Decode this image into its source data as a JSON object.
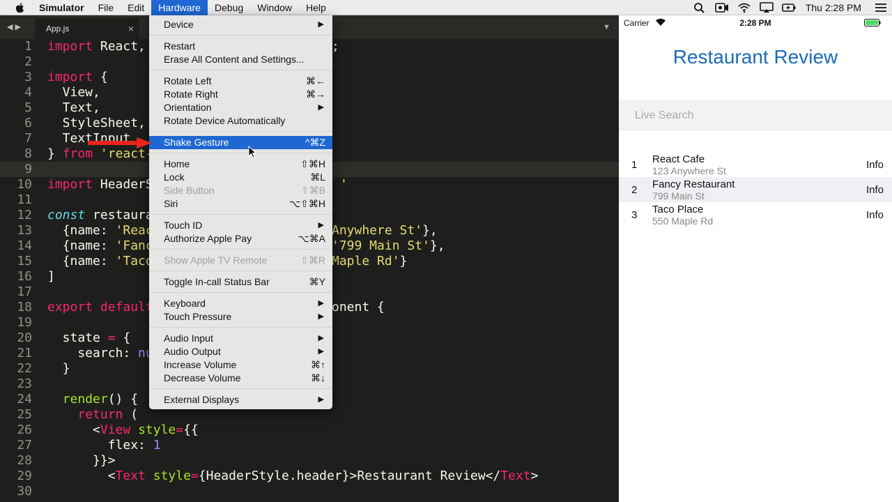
{
  "menubar": {
    "app": "Simulator",
    "items": [
      "File",
      "Edit",
      "Hardware",
      "Debug",
      "Window",
      "Help"
    ],
    "active": "Hardware",
    "clock": "Thu 2:28 PM"
  },
  "editor": {
    "tab": "App.js",
    "close": "×",
    "lines": [
      {
        "n": "1",
        "code": "<span class=\"kw\">import</span> React,"
      },
      {
        "n": "2",
        "code": ""
      },
      {
        "n": "3",
        "code": "<span class=\"kw\">import</span> {"
      },
      {
        "n": "4",
        "code": "  View,"
      },
      {
        "n": "5",
        "code": "  Text,"
      },
      {
        "n": "6",
        "code": "  StyleSheet,"
      },
      {
        "n": "7",
        "code": "  TextInput"
      },
      {
        "n": "8",
        "code": "} <span class=\"kw\">from</span> <span class=\"st\">'react-</span>"
      },
      {
        "n": "9",
        "code": ""
      },
      {
        "n": "10",
        "code": "<span class=\"kw\">import</span> HeaderS"
      },
      {
        "n": "11",
        "code": ""
      },
      {
        "n": "12",
        "code": "<span class=\"it\">const</span> restaura"
      },
      {
        "n": "13",
        "code": "  {name: <span class=\"st\">'Reac</span>"
      },
      {
        "n": "14",
        "code": "  {name: <span class=\"st\">'Fanc</span>"
      },
      {
        "n": "15",
        "code": "  {name: <span class=\"st\">'Taco</span>"
      },
      {
        "n": "16",
        "code": "]"
      },
      {
        "n": "17",
        "code": ""
      },
      {
        "n": "18",
        "code": "<span class=\"kw\">export</span> <span class=\"kw\">default</span>"
      },
      {
        "n": "19",
        "code": ""
      },
      {
        "n": "20",
        "code": "  state <span class=\"kw\">=</span> {"
      },
      {
        "n": "21",
        "code": "    search: <span class=\"nm\">nu</span>"
      },
      {
        "n": "22",
        "code": "  }"
      },
      {
        "n": "23",
        "code": ""
      },
      {
        "n": "24",
        "code": "  <span class=\"fn\">render</span>() {"
      },
      {
        "n": "25",
        "code": "    <span class=\"kw\">return</span> ("
      },
      {
        "n": "26",
        "code": "      &lt;<span class=\"tg\">View</span> <span class=\"at\">style</span><span class=\"kw\">=</span>{{"
      },
      {
        "n": "27",
        "code": "        flex: <span class=\"nm\">1</span>"
      },
      {
        "n": "28",
        "code": "      }}&gt;"
      },
      {
        "n": "29",
        "code": "        &lt;<span class=\"tg\">Text</span> <span class=\"at\">style</span><span class=\"kw\">=</span>{HeaderStyle.header}&gt;Restaurant Review&lt;/<span class=\"tg\">Text</span>&gt;"
      },
      {
        "n": "30",
        "code": ""
      }
    ],
    "fragments": [
      {
        "line": 1,
        "col": 21,
        "html": ";"
      },
      {
        "line": 10,
        "col": 19,
        "html": "<span class=\"st\">'</span>"
      },
      {
        "line": 13,
        "col": 19,
        "html": "<span class=\"st\">Anywhere St'</span>},"
      },
      {
        "line": 14,
        "col": 19,
        "html": "<span class=\"st\">'799 Main St'</span>},"
      },
      {
        "line": 15,
        "col": 19,
        "html": "<span class=\"st\">Maple Rd'</span>}"
      },
      {
        "line": 18,
        "col": 19,
        "html": "onent {"
      }
    ]
  },
  "hardware_menu": {
    "items": [
      {
        "label": "Device",
        "sub": true
      },
      {
        "sep": true
      },
      {
        "label": "Restart"
      },
      {
        "label": "Erase All Content and Settings..."
      },
      {
        "sep": true
      },
      {
        "label": "Rotate Left",
        "shortcut": "⌘←"
      },
      {
        "label": "Rotate Right",
        "shortcut": "⌘→"
      },
      {
        "label": "Orientation",
        "sub": true
      },
      {
        "label": "Rotate Device Automatically"
      },
      {
        "sep": true
      },
      {
        "label": "Shake Gesture",
        "shortcut": "^⌘Z",
        "highlighted": true
      },
      {
        "sep": true
      },
      {
        "label": "Home",
        "shortcut": "⇧⌘H"
      },
      {
        "label": "Lock",
        "shortcut": "⌘L"
      },
      {
        "label": "Side Button",
        "shortcut": "⇧⌘B",
        "disabled": true
      },
      {
        "label": "Siri",
        "shortcut": "⌥⇧⌘H"
      },
      {
        "sep": true
      },
      {
        "label": "Touch ID",
        "sub": true
      },
      {
        "label": "Authorize Apple Pay",
        "shortcut": "⌥⌘A"
      },
      {
        "sep": true
      },
      {
        "label": "Show Apple TV Remote",
        "shortcut": "⇧⌘R",
        "disabled": true
      },
      {
        "sep": true
      },
      {
        "label": "Toggle In-call Status Bar",
        "shortcut": "⌘Y"
      },
      {
        "sep": true
      },
      {
        "label": "Keyboard",
        "sub": true
      },
      {
        "label": "Touch Pressure",
        "sub": true
      },
      {
        "sep": true
      },
      {
        "label": "Audio Input",
        "sub": true
      },
      {
        "label": "Audio Output",
        "sub": true
      },
      {
        "label": "Increase Volume",
        "shortcut": "⌘↑"
      },
      {
        "label": "Decrease Volume",
        "shortcut": "⌘↓"
      },
      {
        "sep": true
      },
      {
        "label": "External Displays",
        "sub": true
      }
    ]
  },
  "simulator": {
    "carrier": "Carrier",
    "time": "2:28 PM",
    "title": "Restaurant Review",
    "search_placeholder": "Live Search",
    "restaurants": [
      {
        "num": "1",
        "name": "React Cafe",
        "address": "123 Anywhere St",
        "action": "Info"
      },
      {
        "num": "2",
        "name": "Fancy Restaurant",
        "address": "799 Main St",
        "action": "Info"
      },
      {
        "num": "3",
        "name": "Taco Place",
        "address": "550 Maple Rd",
        "action": "Info"
      }
    ]
  },
  "colors": {
    "accent": "#1f67d2",
    "title_blue": "#1d6bb5",
    "arrow_red": "#e8261b"
  }
}
